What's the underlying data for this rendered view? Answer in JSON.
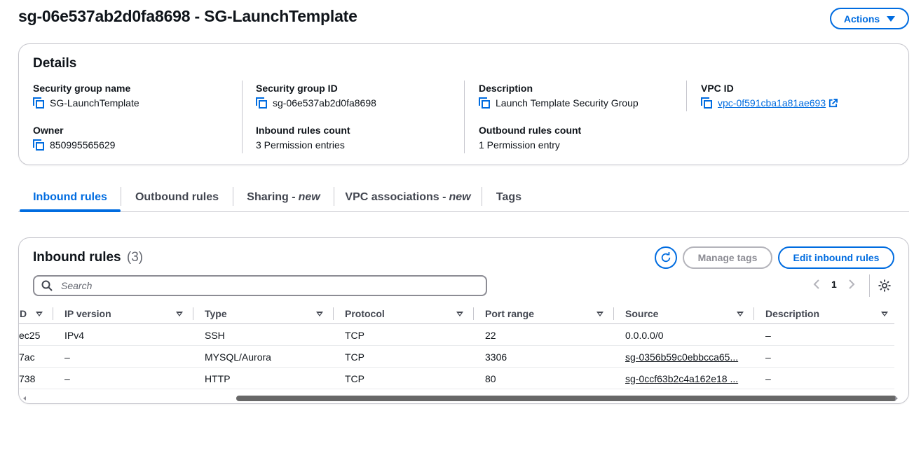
{
  "page": {
    "title": "sg-06e537ab2d0fa8698 - SG-LaunchTemplate",
    "actions_label": "Actions"
  },
  "details": {
    "title": "Details",
    "fields": {
      "sg_name": {
        "label": "Security group name",
        "value": "SG-LaunchTemplate"
      },
      "sg_id": {
        "label": "Security group ID",
        "value": "sg-06e537ab2d0fa8698"
      },
      "description": {
        "label": "Description",
        "value": "Launch Template Security Group"
      },
      "vpc_id": {
        "label": "VPC ID",
        "value": "vpc-0f591cba1a81ae693"
      },
      "owner": {
        "label": "Owner",
        "value": "850995565629"
      },
      "inbound_count": {
        "label": "Inbound rules count",
        "value": "3 Permission entries"
      },
      "outbound_count": {
        "label": "Outbound rules count",
        "value": "1 Permission entry"
      }
    }
  },
  "tabs": [
    {
      "label": "Inbound rules",
      "badge": "",
      "active": true
    },
    {
      "label": "Outbound rules",
      "badge": "",
      "active": false
    },
    {
      "label": "Sharing -",
      "badge": "new",
      "active": false
    },
    {
      "label": "VPC associations -",
      "badge": "new",
      "active": false
    },
    {
      "label": "Tags",
      "badge": "",
      "active": false
    }
  ],
  "inbound": {
    "title": "Inbound rules",
    "count": "(3)",
    "manage_tags_label": "Manage tags",
    "edit_label": "Edit inbound rules",
    "search_placeholder": "Search",
    "page_number": "1",
    "columns": [
      "D",
      "IP version",
      "Type",
      "Protocol",
      "Port range",
      "Source",
      "Description"
    ],
    "rows": [
      {
        "id": "ec25",
        "ip_version": "IPv4",
        "type": "SSH",
        "protocol": "TCP",
        "port_range": "22",
        "source": "0.0.0.0/0",
        "description": "–"
      },
      {
        "id": "7ac",
        "ip_version": "–",
        "type": "MYSQL/Aurora",
        "protocol": "TCP",
        "port_range": "3306",
        "source": "sg-0356b59c0ebbcca65...",
        "description": "–"
      },
      {
        "id": "738",
        "ip_version": "–",
        "type": "HTTP",
        "protocol": "TCP",
        "port_range": "80",
        "source": "sg-0ccf63b2c4a162e18 ...",
        "description": "–"
      }
    ]
  },
  "colors": {
    "accent": "#006ce0",
    "text": "#0f141a",
    "muted": "#656871",
    "border": "#c6c6cd"
  }
}
